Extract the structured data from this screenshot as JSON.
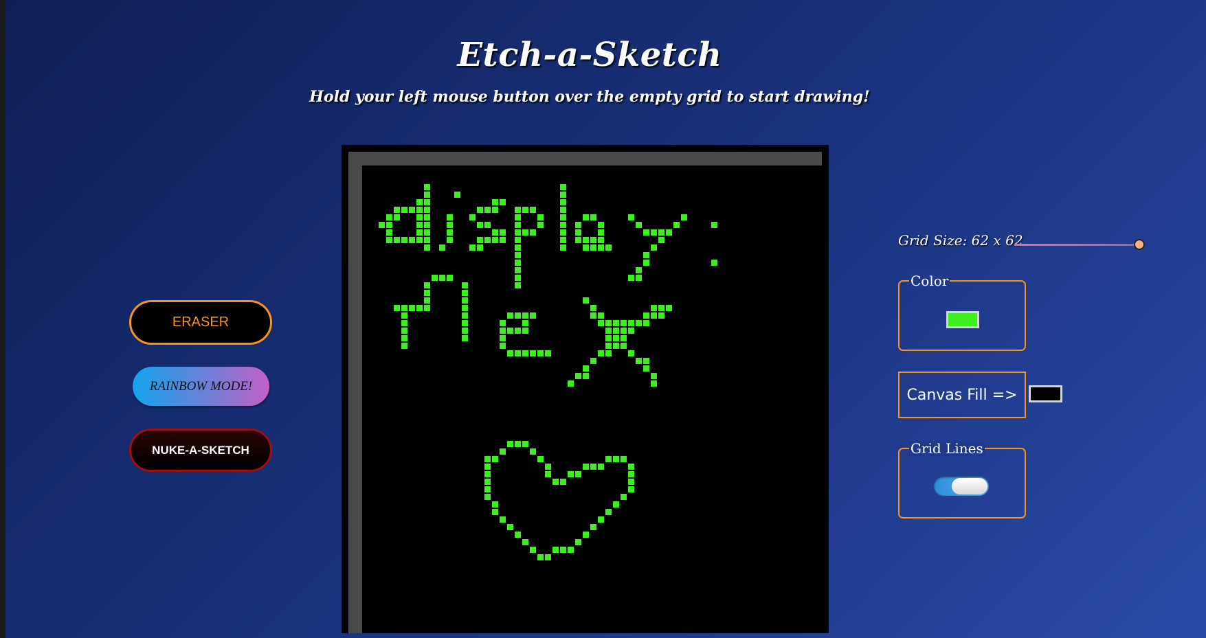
{
  "header": {
    "title": "Etch-a-Sketch",
    "instructions": "Hold your left mouse button over the empty grid to start drawing!"
  },
  "controls": {
    "eraser_label": "ERASER",
    "rainbow_label": "RAINBOW MODE!",
    "nuke_label": "NUKE-A-SKETCH"
  },
  "settings": {
    "grid_size_label": "Grid Size: 62 x 62",
    "grid_size_value": 62,
    "color_legend": "Color",
    "pen_color": "#3cf01e",
    "canvas_fill_label": "Canvas Fill =>",
    "canvas_fill_color": "#000000",
    "grid_lines_legend": "Grid Lines",
    "grid_lines_on": true
  },
  "colors": {
    "accent": "#f7941e",
    "nuke_border": "#a01010",
    "pen": "#3cf01e"
  },
  "drawing": {
    "text_lines": [
      "display:",
      "flex"
    ],
    "includes_heart": true
  }
}
